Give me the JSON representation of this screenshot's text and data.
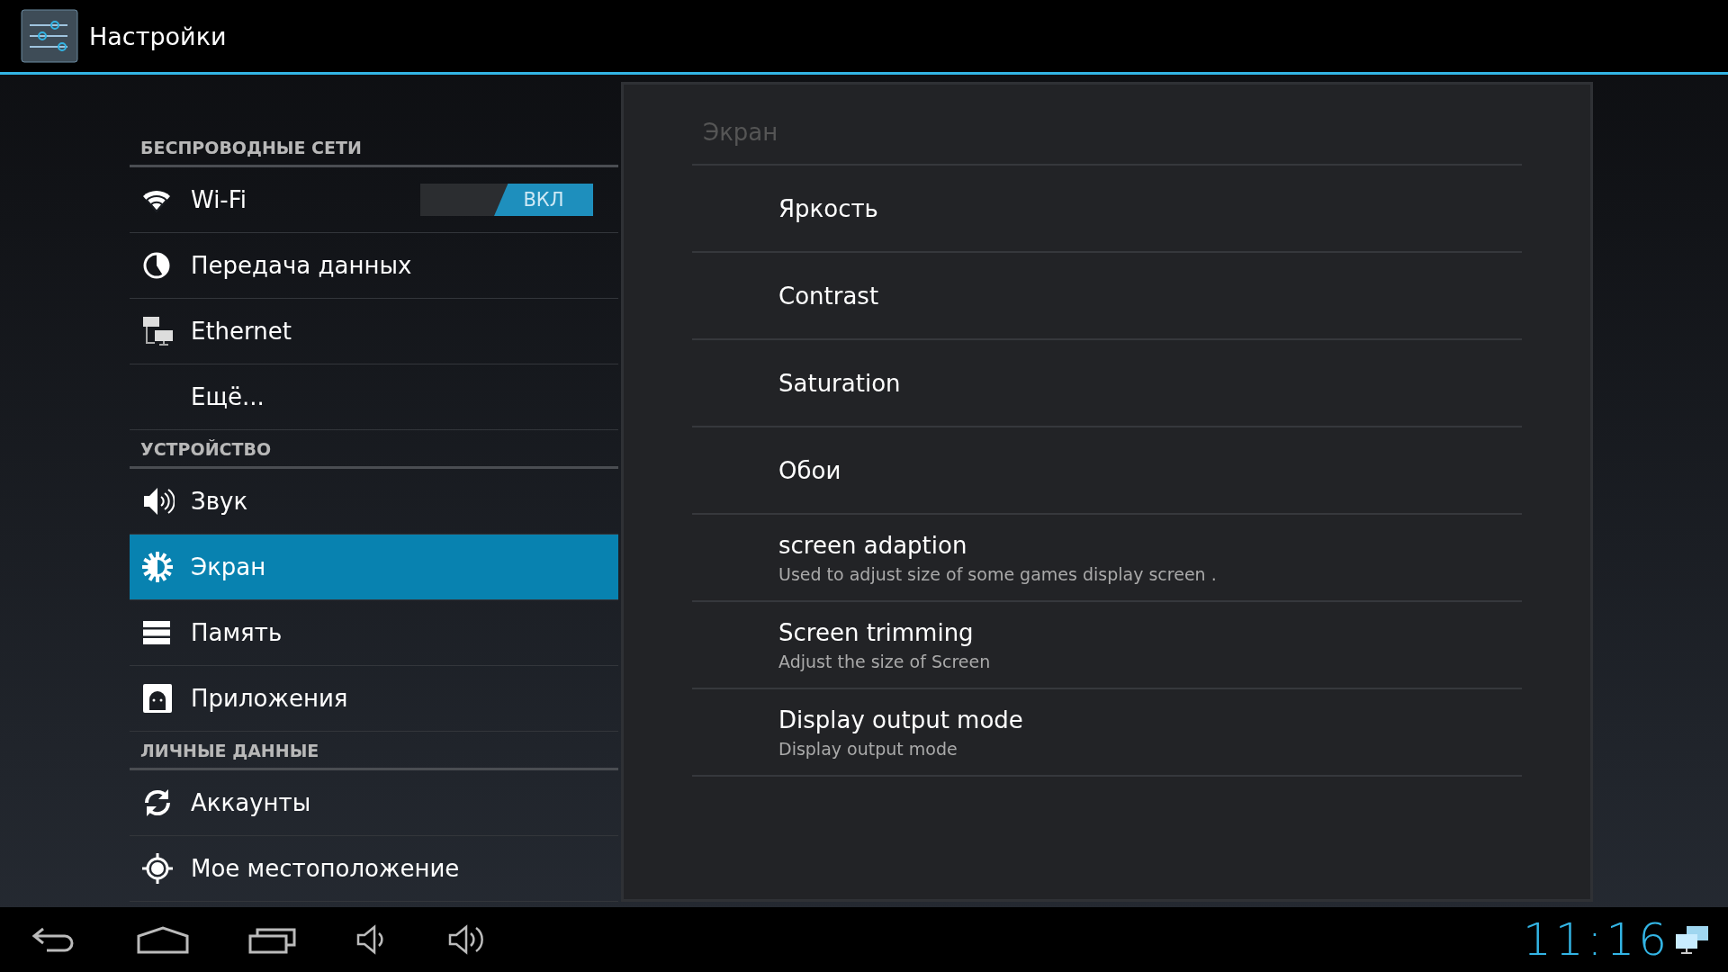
{
  "action_bar": {
    "title": "Настройки"
  },
  "sidebar": {
    "sections": [
      {
        "header": "БЕСПРОВОДНЫЕ СЕТИ",
        "items": [
          {
            "label": "Wi-Fi",
            "selected": false,
            "toggle": {
              "label": "ВКЛ",
              "on": true
            }
          },
          {
            "label": "Передача данных",
            "selected": false
          },
          {
            "label": "Ethernet",
            "selected": false
          },
          {
            "label": "Ещё...",
            "selected": false
          }
        ]
      },
      {
        "header": "УСТРОЙСТВО",
        "items": [
          {
            "label": "Звук",
            "selected": false
          },
          {
            "label": "Экран",
            "selected": true
          },
          {
            "label": "Память",
            "selected": false
          },
          {
            "label": "Приложения",
            "selected": false
          }
        ]
      },
      {
        "header": "ЛИЧНЫЕ ДАННЫЕ",
        "items": [
          {
            "label": "Аккаунты",
            "selected": false
          },
          {
            "label": "Мое местоположение",
            "selected": false
          }
        ]
      }
    ]
  },
  "detail": {
    "title": "Экран",
    "items": [
      {
        "title": "Яркость"
      },
      {
        "title": "Contrast"
      },
      {
        "title": "Saturation"
      },
      {
        "title": "Обои"
      },
      {
        "title": "screen adaption",
        "summary": "Used to adjust size of some games display screen ."
      },
      {
        "title": "Screen trimming",
        "summary": "Adjust the size of Screen"
      },
      {
        "title": "Display output mode",
        "summary": "Display output mode"
      }
    ]
  },
  "nav_bar": {
    "clock": "11:16"
  }
}
